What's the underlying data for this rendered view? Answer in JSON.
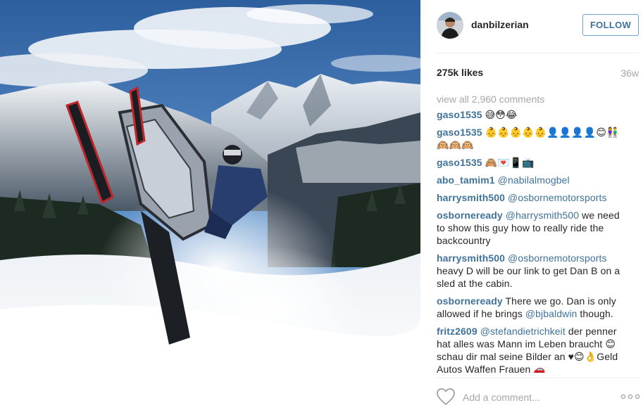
{
  "post": {
    "username": "danbilzerian",
    "follow_label": "FOLLOW",
    "likes": "275k likes",
    "age": "36w",
    "view_all": "view all 2,960 comments",
    "add_comment_placeholder": "Add a comment..."
  },
  "comments": [
    {
      "user": "gaso1535",
      "parts": [
        {
          "t": "text",
          "v": " 😅😳😂"
        }
      ]
    },
    {
      "user": "gaso1535",
      "parts": [
        {
          "t": "text",
          "v": " 👶👶👶👶👶👤👤👤👤😊👫🙉🙉🙉"
        }
      ]
    },
    {
      "user": "gaso1535",
      "parts": [
        {
          "t": "text",
          "v": " 🙈💌📱📺"
        }
      ]
    },
    {
      "user": "abo_tamim1",
      "parts": [
        {
          "t": "text",
          "v": " "
        },
        {
          "t": "mention",
          "v": "@nabilalmogbel"
        }
      ]
    },
    {
      "user": "harrysmith500",
      "parts": [
        {
          "t": "text",
          "v": " "
        },
        {
          "t": "mention",
          "v": "@osbornemotorsports"
        }
      ]
    },
    {
      "user": "osborneready",
      "parts": [
        {
          "t": "text",
          "v": " "
        },
        {
          "t": "mention",
          "v": "@harrysmith500"
        },
        {
          "t": "text",
          "v": " we need to show this guy how to really ride the backcountry"
        }
      ]
    },
    {
      "user": "harrysmith500",
      "parts": [
        {
          "t": "text",
          "v": " "
        },
        {
          "t": "mention",
          "v": "@osbornemotorsports"
        },
        {
          "t": "text",
          "v": " heavy D will be our link to get Dan B on a sled at the cabin."
        }
      ]
    },
    {
      "user": "osborneready",
      "parts": [
        {
          "t": "text",
          "v": " There we go. Dan is only allowed if he brings "
        },
        {
          "t": "mention",
          "v": "@bjbaldwin"
        },
        {
          "t": "text",
          "v": " though."
        }
      ]
    },
    {
      "user": "fritz2609",
      "parts": [
        {
          "t": "text",
          "v": " "
        },
        {
          "t": "mention",
          "v": "@stefandietrichkeit"
        },
        {
          "t": "text",
          "v": " der penner hat alles was Mann im Leben braucht 😊 schau dir mal seine Bilder an ♥😊👌Geld Autos Waffen Frauen 🚗"
        }
      ]
    }
  ],
  "colors": {
    "link": "#3f729b",
    "muted": "#a5a7aa",
    "text": "#262626",
    "follow_border": "#70a0d0"
  },
  "icons": {
    "heart": "heart-outline-icon",
    "more": "more-options-icon"
  }
}
